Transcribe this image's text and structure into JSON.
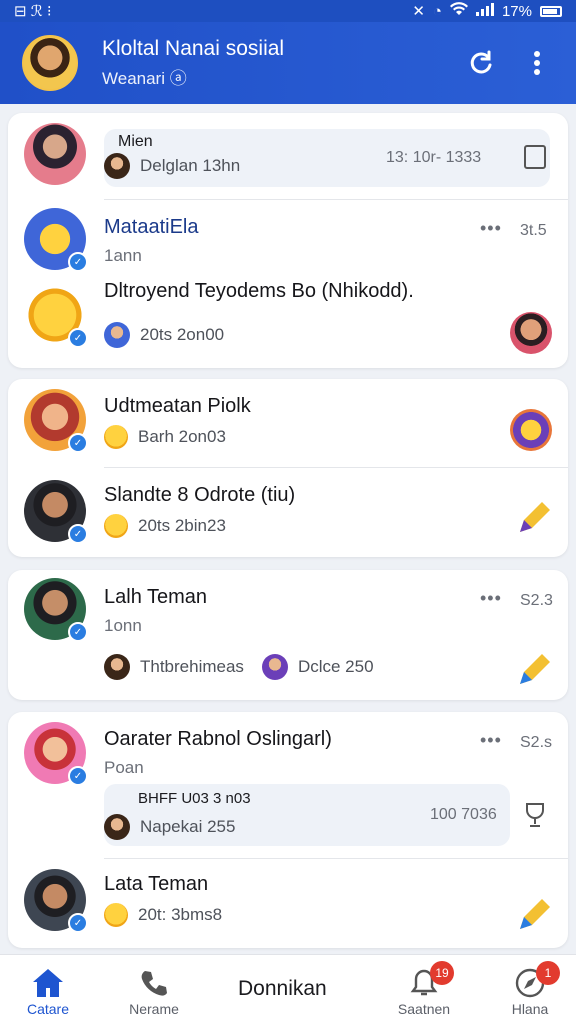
{
  "status_bar": {
    "left": "⊟ ℛ ⁝",
    "right": "17%"
  },
  "app_bar": {
    "title": "Kloltal Nanai sosiial",
    "subtitle": "Weanari ⓐ"
  },
  "feed": {
    "pinned": {
      "label": "Mien",
      "line": "Delglan 13hn",
      "time": "13: 10r- 1333"
    },
    "card1": {
      "name": "MataatiEla",
      "sub": "1ann",
      "time": "3t.5",
      "message": "Dltroyend Teyodems Bo (Nhikodd).",
      "meta": "20ts 2on00"
    },
    "card2": {
      "name": "Udtmeatan Piolk",
      "meta": "Barh 2on03"
    },
    "card3": {
      "name": "Slandte 8 Odrote (tiu)",
      "meta": "20ts 2bin23"
    },
    "card4": {
      "name": "Lalh Teman",
      "sub": "1onn",
      "time": "S2.3",
      "meta1": "Thtbrehimeas",
      "meta2": "Dclce 250"
    },
    "card5": {
      "name": "Oarater Rabnol Oslingarl)",
      "sub": "Poan",
      "time": "S2.s",
      "bubble_title": "BHFF U03 3 n03",
      "bubble_line": "Napekai 255",
      "bubble_time": "100 7036"
    },
    "card6": {
      "name": "Lata Teman",
      "meta": "20t: 3bms8"
    }
  },
  "bottom_nav": {
    "items": [
      {
        "label": "Catare"
      },
      {
        "label": "Nerame"
      },
      {
        "label": "Saatnen",
        "badge": "19"
      },
      {
        "label": "Hlana",
        "badge": "1"
      }
    ],
    "center": "Donnikan"
  },
  "colors": {
    "primary": "#1e4fc0",
    "badge": "#e23b2e",
    "verified": "#2a7de1"
  }
}
